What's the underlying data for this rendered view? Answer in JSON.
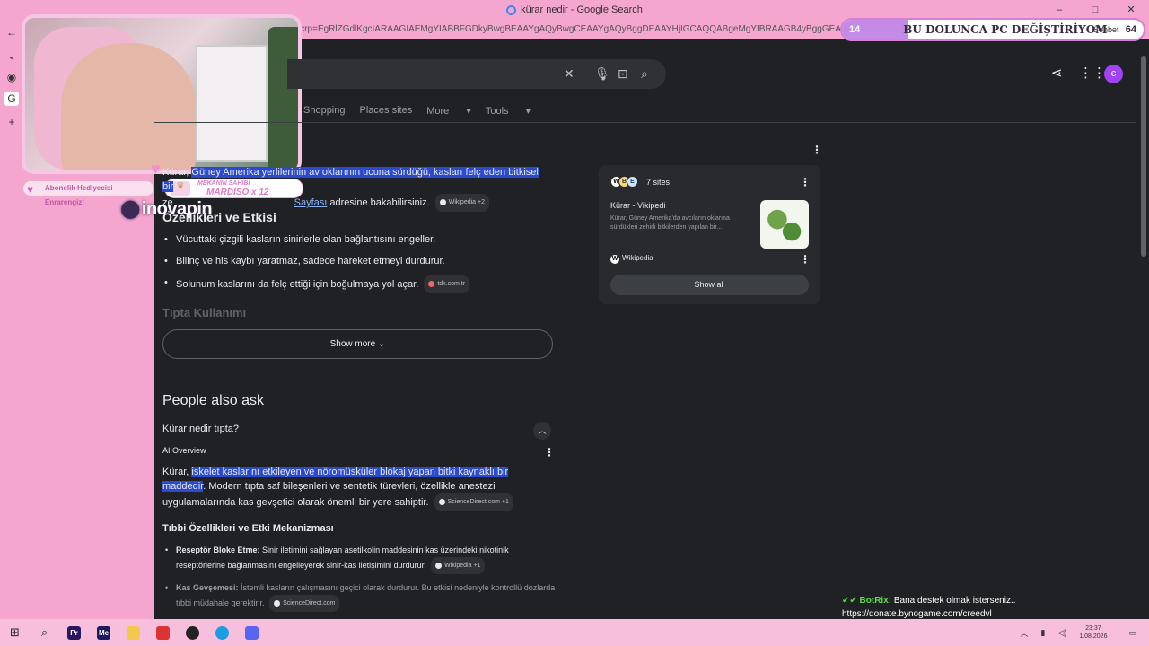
{
  "window": {
    "title": "kürar nedir - Google Search",
    "controls": [
      "–",
      "□",
      "✕"
    ]
  },
  "address_bar": {
    "url_fragment": "lcrp=EgRlZGdlKgcIARAAGIAEMgYIABBFGDkyBwgBEAAYgAQyBwgCEAAYgAQyBggDEAAYHjIGCAQQABgeMgYIBRAAGB4yBggGEAAYHjIGCAcQABge"
  },
  "stream_overlay": {
    "goal": {
      "left_value": "14",
      "text": "BU DOLUNCA PC DEĞİŞTİRİYOM",
      "right_value": "64",
      "progress": 0.219
    },
    "chat_tab": "Sohbet",
    "sub_gift": "Abonelik Hediyecisi Enrarengiz!",
    "owner": {
      "label": "MEKANIN SAHIBI",
      "value": "MARDİSO x 12"
    },
    "sponsor": "inovapin",
    "botrix": {
      "name": "BotRix:",
      "message": "Bana destek olmak isterseniz.."
    },
    "donate_url": "https://donate.bynogame.com/creedvl"
  },
  "search": {
    "tabs": [
      "Shopping",
      "Places sites",
      "More",
      "Tools"
    ],
    "avatar_letter": "c"
  },
  "overview": {
    "para1_prefix": "Kürar, ",
    "para1_hl": "Güney Amerika yerlilerinin av oklarının ucuna sürdüğü, kasları felç eden bitkisel bir",
    "para1_line2a": "ze",
    "para1_link": "Sayfası",
    "para1_line2b": " adresine bakabilirsiniz.",
    "para1_chip": "Wikipedia +2",
    "heading": "Özellikleri ve Etkisi",
    "bullets": [
      "Vücuttaki çizgili kasların sinirlerle olan bağlantısını engeller.",
      "Bilinç ve his kaybı yaratmaz, sadece hareket etmeyi durdurur.",
      "Solunum kaslarını da felç ettiği için boğulmaya yol açar."
    ],
    "bullet3_chip": "tdk.com.tr",
    "faded_heading": "Tıpta Kullanımı",
    "show_more": "Show more"
  },
  "panel": {
    "sites_label": "7 sites",
    "title": "Kürar - Vikipedi",
    "snippet": "Kürar, Güney Amerika'da avcıların oklarına sürdükleri zehirli bitkilerden yapılan bir...",
    "source": "Wikipedia",
    "show_all": "Show all"
  },
  "paa": {
    "title": "People also ask",
    "question": "Kürar nedir tıpta?",
    "ai_overview": "AI Overview",
    "para_prefix": "Kürar, ",
    "para_hl": "iskelet kaslarını etkileyen ve nöromüsküler blokaj yapan bitki kaynaklı bir maddedir",
    "para_rest": ". Modern tıpta saf bileşenleri ve sentetik türevleri, özellikle anestezi uygulamalarında kas gevşetici olarak önemli bir yere sahiptir.",
    "para_chip": "ScienceDirect.com +1",
    "heading": "Tıbbi Özellikleri ve Etki Mekanizması",
    "items": [
      {
        "bold": "Reseptör Bloke Etme:",
        "text": " Sinir iletimini sağlayan asetilkolin maddesinin kas üzerindeki nikotinik reseptörlerine bağlanmasını engelleyerek sinir-kas iletişimini durdurur.",
        "chip": "Wikipedia +1"
      },
      {
        "bold": "Kas Gevşemesi:",
        "text": " İstemli kasların çalışmasını geçici olarak durdurur. Bu etkisi nedeniyle kontrollü dozlarda tıbbi müdahale gerektirir.",
        "chip": "ScienceDirect.com"
      }
    ]
  },
  "taskbar": {
    "clock_time": "23:37",
    "clock_date": "1.08.2026"
  },
  "colors": {
    "theme_pink": "#f4a6cf",
    "highlight": "#2a4bd1",
    "link": "#8ab4f8",
    "page_bg": "#202124"
  }
}
